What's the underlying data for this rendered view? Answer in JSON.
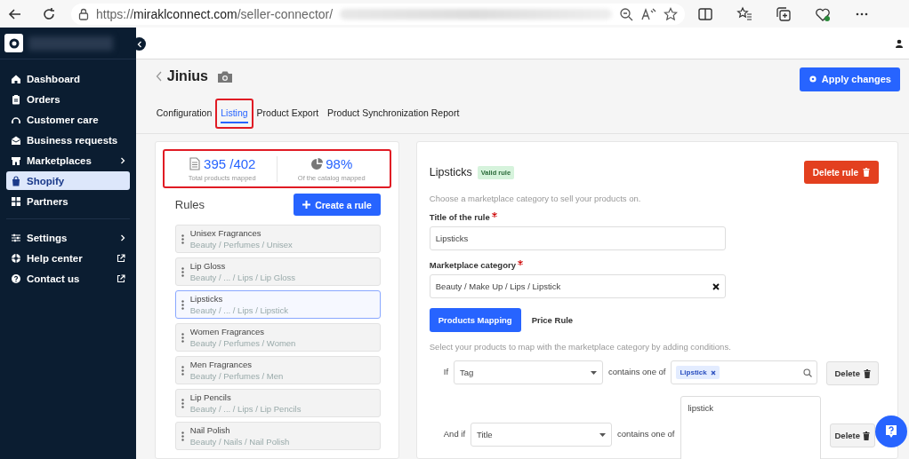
{
  "browser": {
    "url_host": "https://",
    "url_domain": "miraklconnect.com",
    "url_path": "/seller-connector/"
  },
  "sidebar": {
    "items": [
      {
        "label": "Dashboard",
        "selected": false,
        "kind": "plain"
      },
      {
        "label": "Orders",
        "selected": false,
        "kind": "plain"
      },
      {
        "label": "Customer care",
        "selected": false,
        "kind": "plain"
      },
      {
        "label": "Business requests",
        "selected": false,
        "kind": "plain"
      },
      {
        "label": "Marketplaces",
        "selected": false,
        "kind": "submenu"
      },
      {
        "label": "Shopify",
        "selected": true,
        "kind": "plain"
      },
      {
        "label": "Partners",
        "selected": false,
        "kind": "plain"
      }
    ],
    "footer_items": [
      {
        "label": "Settings",
        "selected": false,
        "kind": "submenu"
      },
      {
        "label": "Help center",
        "selected": false,
        "kind": "external"
      },
      {
        "label": "Contact us",
        "selected": false,
        "kind": "external"
      }
    ]
  },
  "page": {
    "title": "Jinius",
    "apply_button": "Apply changes"
  },
  "tabs": [
    {
      "label": "Configuration",
      "selected": false,
      "highlighted": false
    },
    {
      "label": "Listing",
      "selected": true,
      "highlighted": true
    },
    {
      "label": "Product Export",
      "selected": false,
      "highlighted": false
    },
    {
      "label": "Product Synchronization Report",
      "selected": false,
      "highlighted": false
    }
  ],
  "stats": {
    "highlighted": true,
    "items": [
      {
        "value": "395 /402",
        "caption": "Total products mapped"
      },
      {
        "value": "98%",
        "caption": "Of the catalog mapped"
      }
    ]
  },
  "rules": {
    "title": "Rules",
    "create_button": "Create a rule",
    "items": [
      {
        "name": "Unisex Fragrances",
        "path": "Beauty / Perfumes / Unisex",
        "selected": false
      },
      {
        "name": "Lip Gloss",
        "path": "Beauty / ... / Lips / Lip Gloss",
        "selected": false
      },
      {
        "name": "Lipsticks",
        "path": "Beauty / ... / Lips / Lipstick",
        "selected": true
      },
      {
        "name": "Women Fragrances",
        "path": "Beauty / Perfumes / Women",
        "selected": false
      },
      {
        "name": "Men Fragrances",
        "path": "Beauty / Perfumes / Men",
        "selected": false
      },
      {
        "name": "Lip Pencils",
        "path": "Beauty / ... / Lips / Lip Pencils",
        "selected": false
      },
      {
        "name": "Nail Polish",
        "path": "Beauty / Nails / Nail Polish",
        "selected": false
      }
    ]
  },
  "editor": {
    "title": "Lipsticks",
    "badge": "Valid rule",
    "delete_button": "Delete rule",
    "description": "Choose a marketplace category to sell your products on.",
    "title_label": "Title of the rule",
    "title_required": true,
    "title_value": "Lipsticks",
    "category_label": "Marketplace category",
    "category_required": true,
    "category_value": "Beauty / Make Up / Lips / Lipstick",
    "mapping_tabs": [
      {
        "label": "Products Mapping",
        "selected": true
      },
      {
        "label": "Price Rule",
        "selected": false
      }
    ],
    "mapping_description": "Select your products to map with the marketplace category by adding conditions.",
    "conditions": [
      {
        "connector": "If",
        "field": "Tag",
        "operator": "contains one of",
        "kind": "tags",
        "tags": [
          "Lipstick"
        ],
        "delete_button": "Delete"
      },
      {
        "connector": "And if",
        "field": "Title",
        "operator": "contains one of",
        "kind": "text",
        "value": "lipstick",
        "delete_button": "Delete"
      }
    ]
  }
}
